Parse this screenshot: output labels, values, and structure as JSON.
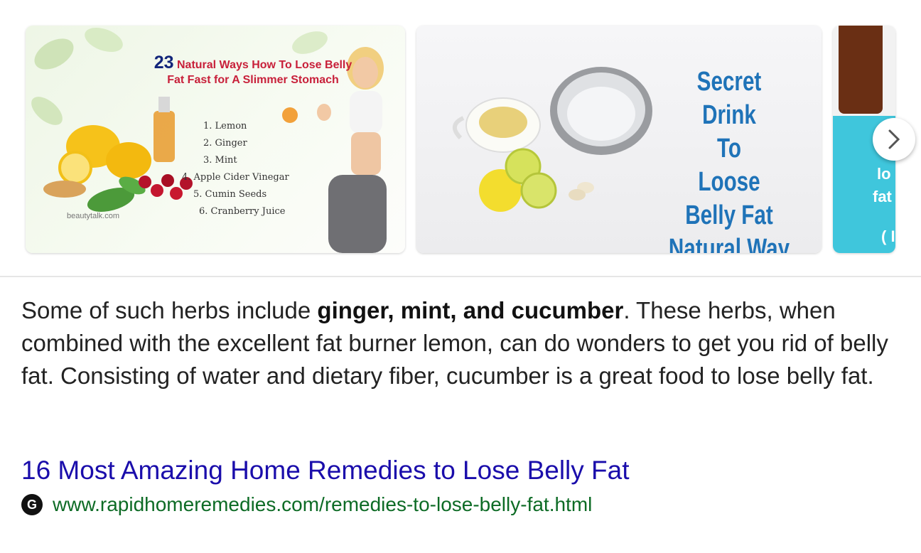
{
  "carousel": {
    "images": [
      {
        "title_num": "23",
        "title_text": "Natural Ways How To Lose Belly Fat Fast for A Slimmer Stomach",
        "list": [
          "1. Lemon",
          "2. Ginger",
          "3. Mint",
          "4. Apple Cider Vinegar",
          "5. Cumin Seeds",
          "6. Cranberry Juice"
        ],
        "source": "beautytalk.com"
      },
      {
        "lines": [
          "Secret Drink",
          "To",
          "Loose",
          "Belly Fat",
          "Natural Way"
        ]
      },
      {
        "partial_lines": [
          "lo",
          "fat",
          "( I"
        ]
      }
    ],
    "next_icon": "chevron-right-icon"
  },
  "snippet": {
    "before": "Some of such herbs include ",
    "bold": "ginger, mint, and cucumber",
    "after": ". These herbs, when combined with the excellent fat burner lemon, can do wonders to get you rid of belly fat. Consisting of water and dietary fiber, cucumber is a great food to lose belly fat."
  },
  "result": {
    "title": "16 Most Amazing Home Remedies to Lose Belly Fat",
    "favicon_letter": "G",
    "url": "www.rapidhomeremedies.com/remedies-to-lose-belly-fat.html"
  },
  "colors": {
    "link": "#1a0dab",
    "url": "#0d6b25",
    "thumb2_text": "#1f73b8",
    "thumb1_title": "#c8203a"
  }
}
